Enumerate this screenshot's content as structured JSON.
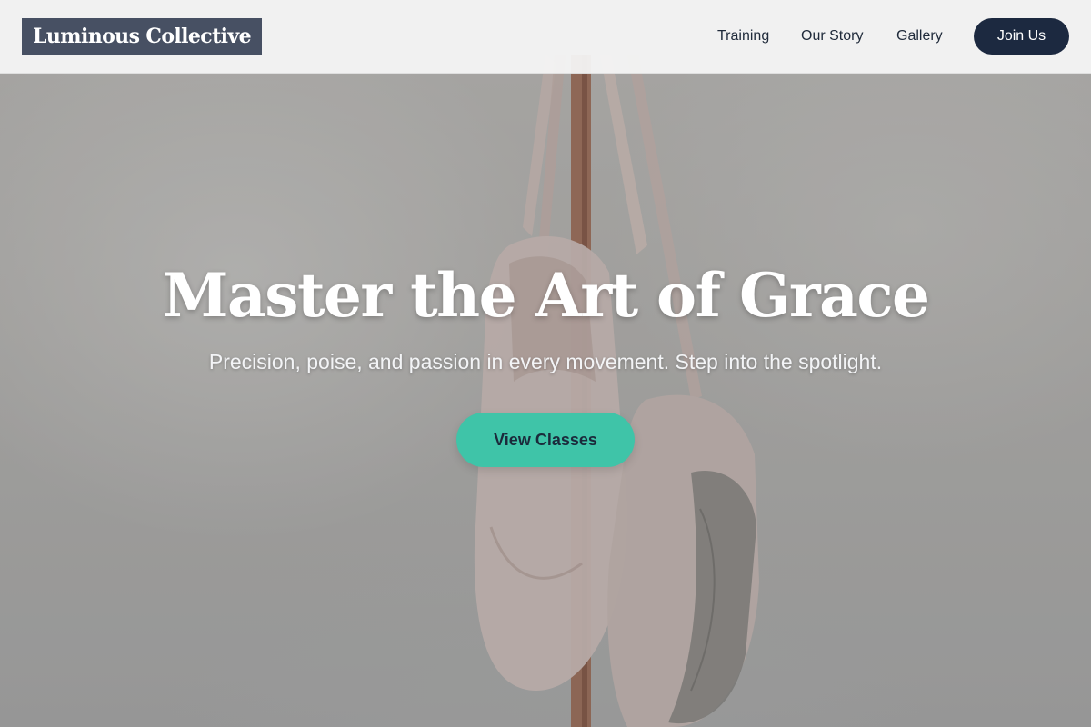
{
  "header": {
    "logo_text": "Luminous Collective",
    "nav": [
      {
        "label": "Training"
      },
      {
        "label": "Our Story"
      },
      {
        "label": "Gallery"
      }
    ],
    "join_label": "Join Us"
  },
  "hero": {
    "title": "Master the Art of Grace",
    "subtitle": "Precision, poise, and passion in every movement. Step into the spotlight.",
    "cta_label": "View Classes",
    "background": "ballet-pointe-shoes-photo"
  },
  "colors": {
    "header_bg": "#f5f5f5",
    "logo_bg": "#475063",
    "join_bg": "#1c2940",
    "cta_bg": "#3fc4a8",
    "cta_text": "#1b2a3b"
  }
}
